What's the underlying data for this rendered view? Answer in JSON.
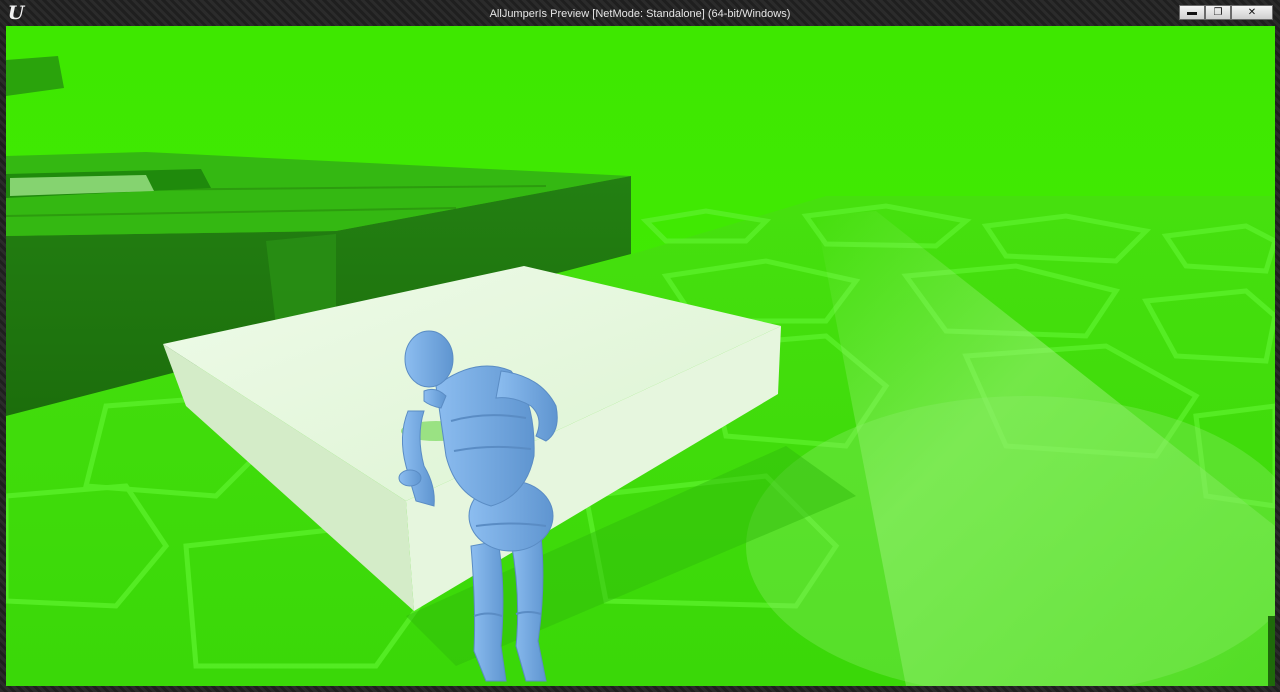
{
  "window": {
    "title": "AllJumperIs Preview [NetMode: Standalone] (64-bit/Windows)",
    "logo_glyph": "U",
    "logo_icon": "unreal-engine-logo-icon",
    "controls": {
      "minimize_glyph": "▬",
      "minimize_icon": "minimize-icon",
      "restore_glyph": "❐",
      "restore_icon": "restore-icon",
      "close_glyph": "✕",
      "close_icon": "close-icon"
    }
  },
  "scene": {
    "sky_color": "#3be600",
    "floor_color": "#47e014",
    "block_color": "#e4f5dc",
    "mannequin_color": "#7aaee6",
    "platform_color": "#2a8a10"
  }
}
